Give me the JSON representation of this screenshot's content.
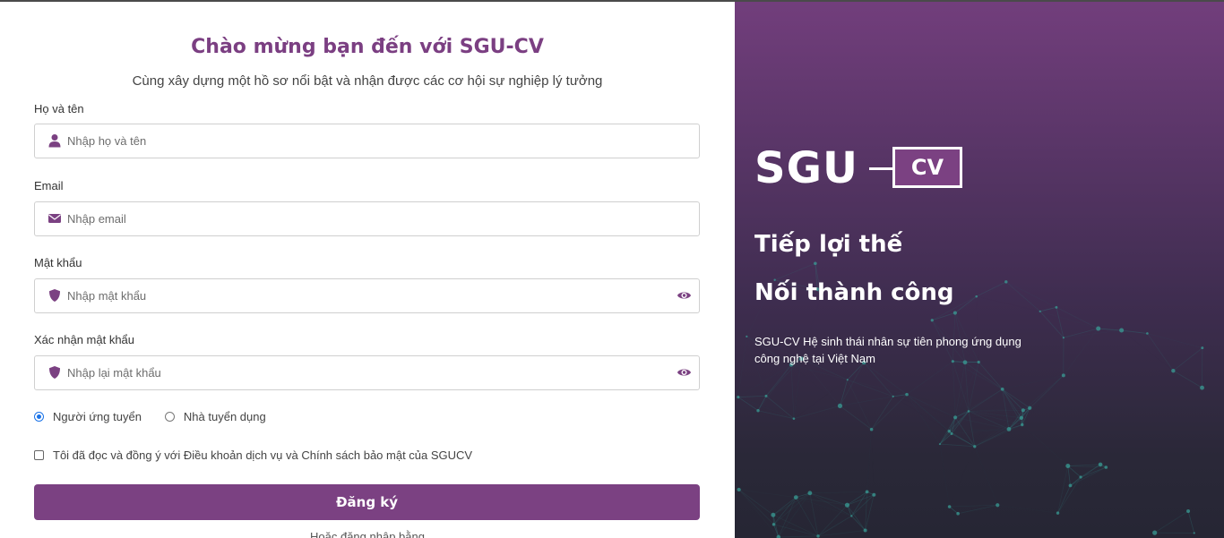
{
  "form": {
    "title": "Chào mừng bạn đến với SGU-CV",
    "subtitle": "Cùng xây dựng một hồ sơ nổi bật và nhận được các cơ hội sự nghiệp lý tưởng",
    "fullname": {
      "label": "Họ và tên",
      "placeholder": "Nhập họ và tên",
      "value": "",
      "icon": "user-icon"
    },
    "email": {
      "label": "Email",
      "placeholder": "Nhập email",
      "value": "",
      "icon": "envelope-icon"
    },
    "password": {
      "label": "Mật khẩu",
      "placeholder": "Nhập mật khẩu",
      "value": "",
      "icon": "shield-icon"
    },
    "confirm_password": {
      "label": "Xác nhận mật khẩu",
      "placeholder": "Nhập lại mật khẩu",
      "value": "",
      "icon": "shield-icon"
    },
    "role_options": [
      {
        "label": "Người ứng tuyển",
        "checked": true
      },
      {
        "label": "Nhà tuyển dụng",
        "checked": false
      }
    ],
    "agree_text": "Tôi đã đọc và đồng ý với Điều khoản dịch vụ và Chính sách bảo mật của SGUCV",
    "agree_checked": false,
    "submit_label": "Đăng ký",
    "alt_login_text": "Hoặc đăng nhập bằng"
  },
  "brand": {
    "logo_main": "SGU",
    "logo_box": "CV",
    "headline_1": "Tiếp lợi thế",
    "headline_2": "Nối thành công",
    "description": "SGU-CV Hệ sinh thái nhân sự tiên phong ứng dụng công nghệ tại Việt Nam"
  },
  "colors": {
    "accent": "#7b4182",
    "title": "#7b3f82",
    "radio_checked": "#1a73e8",
    "panel_top": "#723e7c",
    "panel_bottom": "#262634",
    "network_line": "#2f7f7f"
  }
}
